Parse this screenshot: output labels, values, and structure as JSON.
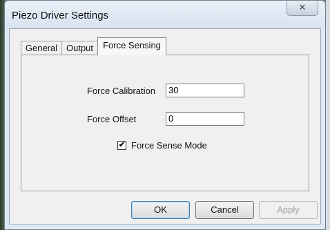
{
  "window": {
    "title": "Piezo Driver Settings",
    "close_glyph": "✕"
  },
  "tabs": [
    {
      "label": "General",
      "active": false
    },
    {
      "label": "Output",
      "active": false
    },
    {
      "label": "Force Sensing",
      "active": true
    }
  ],
  "fields": {
    "force_calibration": {
      "label": "Force Calibration",
      "value": "30"
    },
    "force_offset": {
      "label": "Force Offset",
      "value": "0"
    }
  },
  "force_sense_mode": {
    "label": "Force Sense Mode",
    "checked": true,
    "glyph": "✔"
  },
  "buttons": {
    "ok": "OK",
    "cancel": "Cancel",
    "apply": "Apply"
  }
}
